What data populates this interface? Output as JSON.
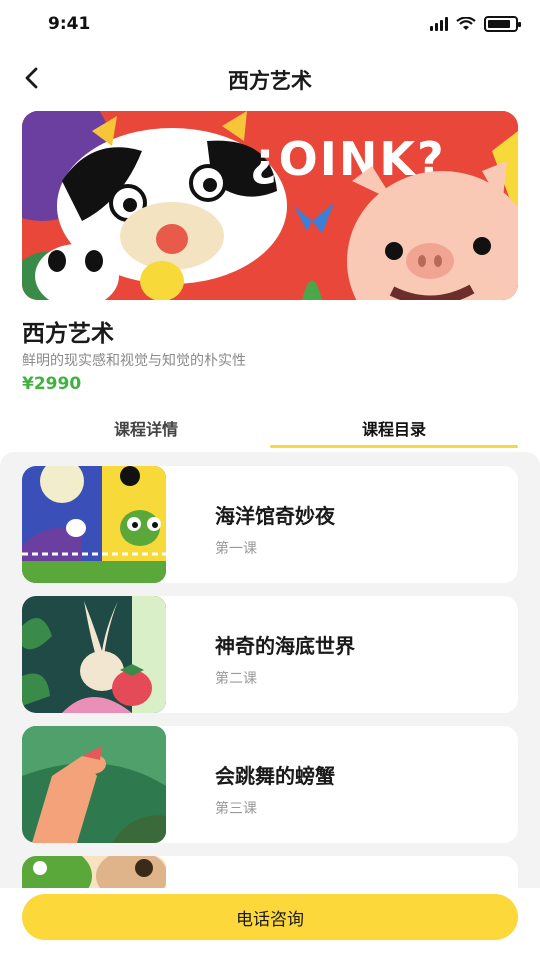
{
  "status_bar": {
    "time": "9:41"
  },
  "nav": {
    "title": "西方艺术"
  },
  "banner": {
    "text": "¿OINK?"
  },
  "course": {
    "title": "西方艺术",
    "subtitle": "鲜明的现实感和视觉与知觉的朴实性",
    "price": "¥2990"
  },
  "tabs": [
    {
      "label": "课程详情",
      "active": false
    },
    {
      "label": "课程目录",
      "active": true
    }
  ],
  "lessons": [
    {
      "title": "海洋馆奇妙夜",
      "sub": "第一课"
    },
    {
      "title": "神奇的海底世界",
      "sub": "第二课"
    },
    {
      "title": "会跳舞的螃蟹",
      "sub": "第三课"
    },
    {
      "title": "",
      "sub": ""
    }
  ],
  "bottom": {
    "consult_label": "电话咨询"
  },
  "colors": {
    "accent": "#fcd83a",
    "price": "#3fb23f",
    "banner_bg": "#e8473a"
  }
}
